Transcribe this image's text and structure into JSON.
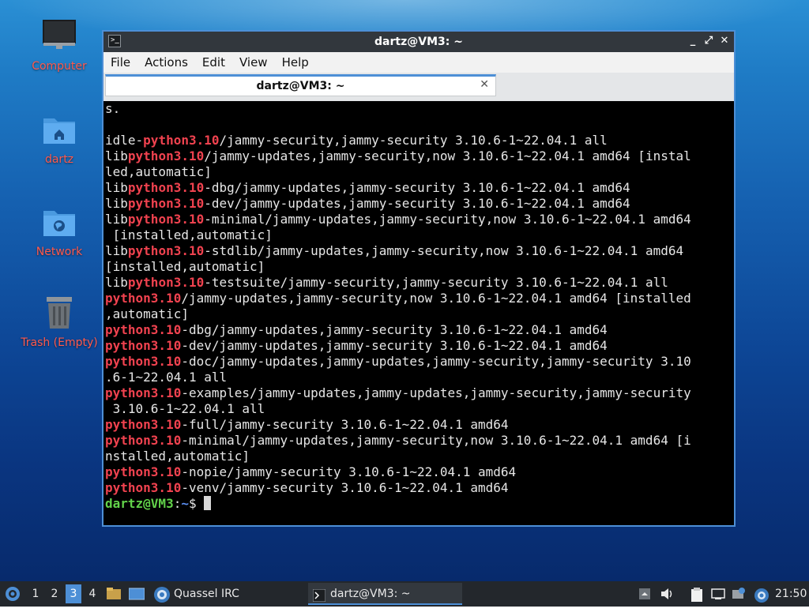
{
  "desktop": {
    "icons": [
      {
        "label": "Computer",
        "icon": "monitor-icon"
      },
      {
        "label": "dartz",
        "icon": "home-folder-icon"
      },
      {
        "label": "Network",
        "icon": "network-folder-icon"
      },
      {
        "label": "Trash (Empty)",
        "icon": "trash-icon"
      }
    ]
  },
  "window": {
    "title": "dartz@VM3: ~",
    "controls": {
      "minimize": "_",
      "maximize": "⤢",
      "close": "✕"
    },
    "menu": [
      "File",
      "Actions",
      "Edit",
      "View",
      "Help"
    ],
    "tab": {
      "label": "dartz@VM3: ~",
      "close": "✕"
    }
  },
  "terminal": {
    "lines": [
      [
        {
          "t": "s."
        }
      ],
      [
        {
          "t": ""
        }
      ],
      [
        {
          "t": "idle-"
        },
        {
          "t": "python3.10",
          "hl": true
        },
        {
          "t": "/jammy-security,jammy-security 3.10.6-1~22.04.1 all"
        }
      ],
      [
        {
          "t": "lib"
        },
        {
          "t": "python3.10",
          "hl": true
        },
        {
          "t": "/jammy-updates,jammy-security,now 3.10.6-1~22.04.1 amd64 [instal"
        }
      ],
      [
        {
          "t": "led,automatic]"
        }
      ],
      [
        {
          "t": "lib"
        },
        {
          "t": "python3.10",
          "hl": true
        },
        {
          "t": "-dbg/jammy-updates,jammy-security 3.10.6-1~22.04.1 amd64"
        }
      ],
      [
        {
          "t": "lib"
        },
        {
          "t": "python3.10",
          "hl": true
        },
        {
          "t": "-dev/jammy-updates,jammy-security 3.10.6-1~22.04.1 amd64"
        }
      ],
      [
        {
          "t": "lib"
        },
        {
          "t": "python3.10",
          "hl": true
        },
        {
          "t": "-minimal/jammy-updates,jammy-security,now 3.10.6-1~22.04.1 amd64"
        }
      ],
      [
        {
          "t": " [installed,automatic]"
        }
      ],
      [
        {
          "t": "lib"
        },
        {
          "t": "python3.10",
          "hl": true
        },
        {
          "t": "-stdlib/jammy-updates,jammy-security,now 3.10.6-1~22.04.1 amd64"
        }
      ],
      [
        {
          "t": "[installed,automatic]"
        }
      ],
      [
        {
          "t": "lib"
        },
        {
          "t": "python3.10",
          "hl": true
        },
        {
          "t": "-testsuite/jammy-security,jammy-security 3.10.6-1~22.04.1 all"
        }
      ],
      [
        {
          "t": "python3.10",
          "hl": true
        },
        {
          "t": "/jammy-updates,jammy-security,now 3.10.6-1~22.04.1 amd64 [installed"
        }
      ],
      [
        {
          "t": ",automatic]"
        }
      ],
      [
        {
          "t": "python3.10",
          "hl": true
        },
        {
          "t": "-dbg/jammy-updates,jammy-security 3.10.6-1~22.04.1 amd64"
        }
      ],
      [
        {
          "t": "python3.10",
          "hl": true
        },
        {
          "t": "-dev/jammy-updates,jammy-security 3.10.6-1~22.04.1 amd64"
        }
      ],
      [
        {
          "t": "python3.10",
          "hl": true
        },
        {
          "t": "-doc/jammy-updates,jammy-updates,jammy-security,jammy-security 3.10"
        }
      ],
      [
        {
          "t": ".6-1~22.04.1 all"
        }
      ],
      [
        {
          "t": "python3.10",
          "hl": true
        },
        {
          "t": "-examples/jammy-updates,jammy-updates,jammy-security,jammy-security"
        }
      ],
      [
        {
          "t": " 3.10.6-1~22.04.1 all"
        }
      ],
      [
        {
          "t": "python3.10",
          "hl": true
        },
        {
          "t": "-full/jammy-security 3.10.6-1~22.04.1 amd64"
        }
      ],
      [
        {
          "t": "python3.10",
          "hl": true
        },
        {
          "t": "-minimal/jammy-updates,jammy-security,now 3.10.6-1~22.04.1 amd64 [i"
        }
      ],
      [
        {
          "t": "nstalled,automatic]"
        }
      ],
      [
        {
          "t": "python3.10",
          "hl": true
        },
        {
          "t": "-nopie/jammy-security 3.10.6-1~22.04.1 amd64"
        }
      ],
      [
        {
          "t": "python3.10",
          "hl": true
        },
        {
          "t": "-venv/jammy-security 3.10.6-1~22.04.1 amd64"
        }
      ]
    ],
    "prompt": {
      "user": "dartz@VM3",
      "sep": ":",
      "path": "~",
      "symbol": "$ "
    }
  },
  "taskbar": {
    "start_icon": "lubuntu-start-icon",
    "workspaces": [
      "1",
      "2",
      "3",
      "4"
    ],
    "active_workspace": "3",
    "tasks": [
      {
        "label": "Quassel IRC",
        "icon": "quassel-icon"
      },
      {
        "label": "dartz@VM3: ~",
        "icon": "terminal-icon"
      }
    ],
    "clock": "21:50"
  },
  "colors": {
    "accent": "#4d8fd6",
    "highlight": "#f0424f",
    "prompt_user": "#62d24a",
    "prompt_path": "#5b8ef0"
  }
}
